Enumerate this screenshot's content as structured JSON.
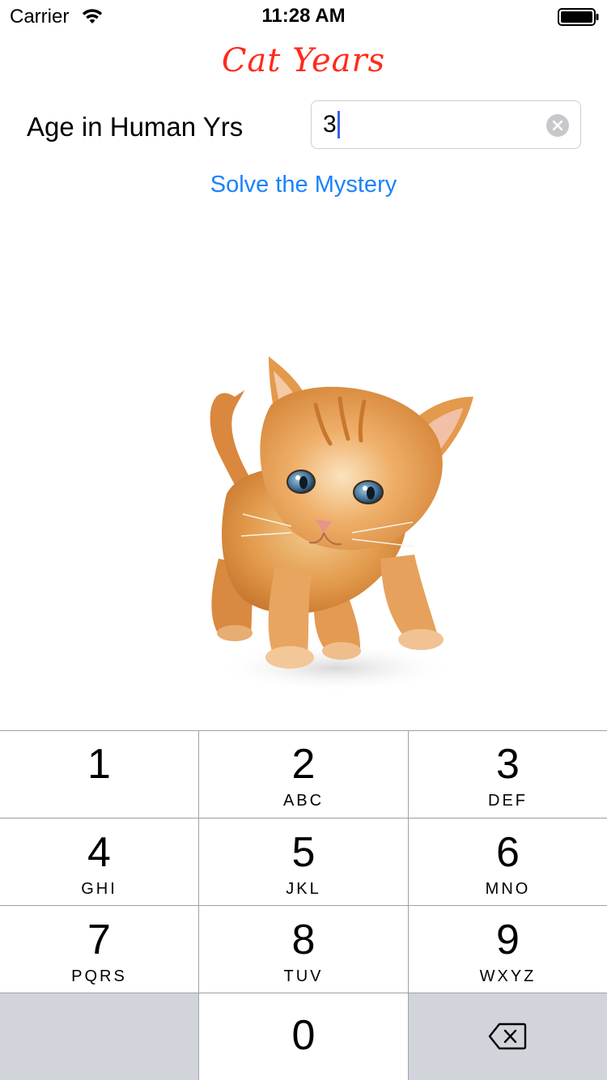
{
  "status_bar": {
    "carrier": "Carrier",
    "time": "11:28 AM",
    "wifi_icon": "wifi-icon",
    "battery_icon": "battery-icon"
  },
  "app": {
    "title": "Cat Years",
    "title_color": "#ff2a1a"
  },
  "form": {
    "age_label": "Age in Human Yrs",
    "age_value": "3",
    "clear_icon": "clear-icon",
    "solve_label": "Solve the Mystery",
    "accent_color": "#1a82fb"
  },
  "image": {
    "subject": "kitten"
  },
  "keypad": {
    "keys": [
      {
        "digit": "1",
        "letters": ""
      },
      {
        "digit": "2",
        "letters": "ABC"
      },
      {
        "digit": "3",
        "letters": "DEF"
      },
      {
        "digit": "4",
        "letters": "GHI"
      },
      {
        "digit": "5",
        "letters": "JKL"
      },
      {
        "digit": "6",
        "letters": "MNO"
      },
      {
        "digit": "7",
        "letters": "PQRS"
      },
      {
        "digit": "8",
        "letters": "TUV"
      },
      {
        "digit": "9",
        "letters": "WXYZ"
      },
      {
        "digit": "0",
        "letters": ""
      }
    ],
    "delete_icon": "backspace-icon"
  }
}
